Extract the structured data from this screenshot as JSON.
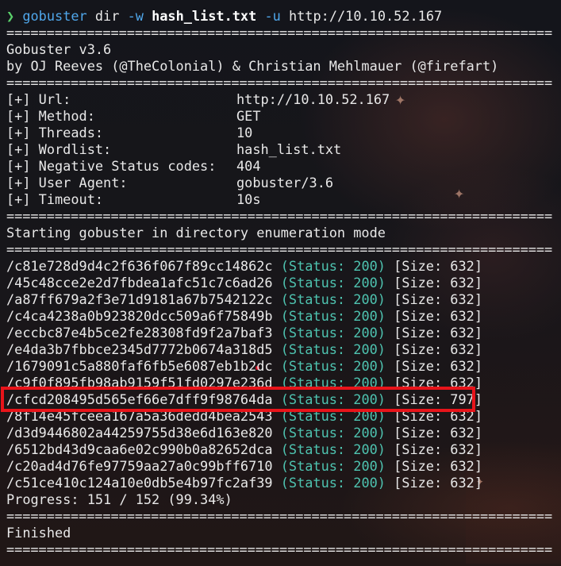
{
  "prompt": {
    "symbol": "❯",
    "command": "gobuster",
    "subcommand": " dir ",
    "flag_w": "-w",
    "wordlist": "hash_list.txt",
    "flag_u": "-u",
    "url": "http://10.10.52.167"
  },
  "separator": "====================================================================",
  "banner": {
    "title": "Gobuster v3.6",
    "authors": "by OJ Reeves (@TheColonial) & Christian Mehlmauer (@firefart)"
  },
  "config": [
    {
      "key": "[+] Url:",
      "value": "http://10.10.52.167"
    },
    {
      "key": "[+] Method:",
      "value": "GET"
    },
    {
      "key": "[+] Threads:",
      "value": "10"
    },
    {
      "key": "[+] Wordlist:",
      "value": "hash_list.txt"
    },
    {
      "key": "[+] Negative Status codes:",
      "value": "404"
    },
    {
      "key": "[+] User Agent:",
      "value": "gobuster/3.6"
    },
    {
      "key": "[+] Timeout:",
      "value": "10s"
    }
  ],
  "start_message": "Starting gobuster in directory enumeration mode",
  "results": [
    {
      "path": "/c81e728d9d4c2f636f067f89cc14862c",
      "status": "(Status: 200)",
      "size": "[Size: 632]"
    },
    {
      "path": "/45c48cce2e2d7fbdea1afc51c7c6ad26",
      "status": "(Status: 200)",
      "size": "[Size: 632]"
    },
    {
      "path": "/a87ff679a2f3e71d9181a67b7542122c",
      "status": "(Status: 200)",
      "size": "[Size: 632]"
    },
    {
      "path": "/c4ca4238a0b923820dcc509a6f75849b",
      "status": "(Status: 200)",
      "size": "[Size: 632]"
    },
    {
      "path": "/eccbc87e4b5ce2fe28308fd9f2a7baf3",
      "status": "(Status: 200)",
      "size": "[Size: 632]"
    },
    {
      "path": "/e4da3b7fbbce2345d7772b0674a318d5",
      "status": "(Status: 200)",
      "size": "[Size: 632]"
    },
    {
      "path": "/1679091c5a880faf6fb5e6087eb1b2dc",
      "status": "(Status: 200)",
      "size": "[Size: 632]"
    },
    {
      "path": "/c9f0f895fb98ab9159f51fd0297e236d",
      "status": "(Status: 200)",
      "size": "[Size: 632]"
    },
    {
      "path": "/cfcd208495d565ef66e7dff9f98764da",
      "status": "(Status: 200)",
      "size": "[Size: 797]"
    },
    {
      "path": "/8f14e45fceea167a5a36dedd4bea2543",
      "status": "(Status: 200)",
      "size": "[Size: 632]"
    },
    {
      "path": "/d3d9446802a44259755d38e6d163e820",
      "status": "(Status: 200)",
      "size": "[Size: 632]"
    },
    {
      "path": "/6512bd43d9caa6e02c990b0a82652dca",
      "status": "(Status: 200)",
      "size": "[Size: 632]"
    },
    {
      "path": "/c20ad4d76fe97759aa27a0c99bff6710",
      "status": "(Status: 200)",
      "size": "[Size: 632]"
    },
    {
      "path": "/c51ce410c124a10e0db5e4b97fc2af39",
      "status": "(Status: 200)",
      "size": "[Size: 632]"
    }
  ],
  "progress": "Progress: 151 / 152 (99.34%)",
  "finished": "Finished",
  "colors": {
    "prompt": "#5ad16b",
    "command": "#4fa6ea",
    "status": "#4ec3b0",
    "highlight": "#e8141a"
  }
}
